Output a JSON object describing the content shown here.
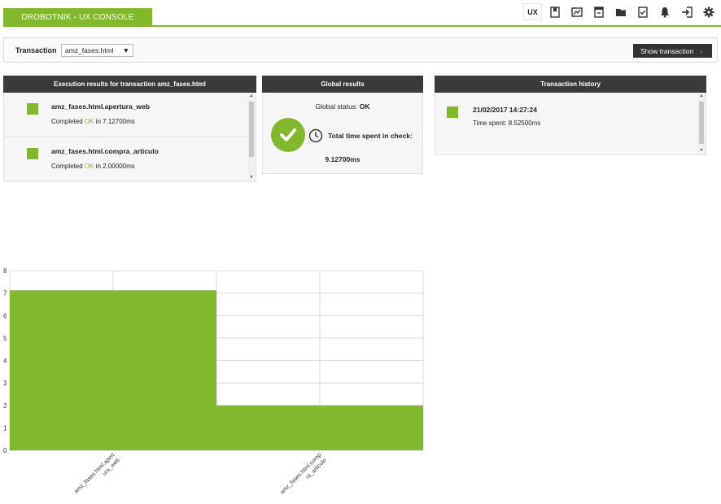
{
  "header": {
    "title": "DROBOTNIK - UX CONSOLE",
    "toolbar": [
      {
        "label": "UX",
        "icon": "ux-text"
      },
      {
        "icon": "bookmark-icon"
      },
      {
        "icon": "chart-icon"
      },
      {
        "icon": "archive-icon"
      },
      {
        "icon": "folder-icon"
      },
      {
        "icon": "checklist-icon"
      },
      {
        "icon": "bell-icon"
      },
      {
        "icon": "logout-icon"
      },
      {
        "icon": "gear-icon"
      }
    ]
  },
  "transaction_bar": {
    "label": "Transaction",
    "selected": "amz_fases.html",
    "button": "Show transaction"
  },
  "execution": {
    "title": "Execution results for transaction amz_fases.html",
    "items": [
      {
        "name": "amz_fases.html.apertura_web",
        "prefix": "Completed",
        "status": "OK",
        "suffix": "in 7.12700ms"
      },
      {
        "name": "amz_fases.html.compra_articulo",
        "prefix": "Completed",
        "status": "OK",
        "suffix": "in 2.00000ms"
      }
    ]
  },
  "global": {
    "title": "Global results",
    "status_label": "Global status:",
    "status_value": "OK",
    "time_label": "Total time spent in check:",
    "time_value": "9.12700ms"
  },
  "history": {
    "title": "Transaction history",
    "date": "21/02/2017 14:27:24",
    "spent": "Time spent: 8.52500ms"
  },
  "colors": {
    "accent": "#82b92c",
    "dark": "#3a3a3a"
  },
  "chart_data": {
    "type": "bar",
    "categories": [
      "amz_fases.html.apert\nura_web",
      "amz_fases.html.comp\nra_articulo"
    ],
    "values": [
      7.127,
      2.0
    ],
    "ylim": [
      0,
      8
    ],
    "yticks": [
      0,
      1,
      2,
      3,
      4,
      5,
      6,
      7,
      8
    ],
    "grid": true,
    "color": "#82b92c"
  }
}
